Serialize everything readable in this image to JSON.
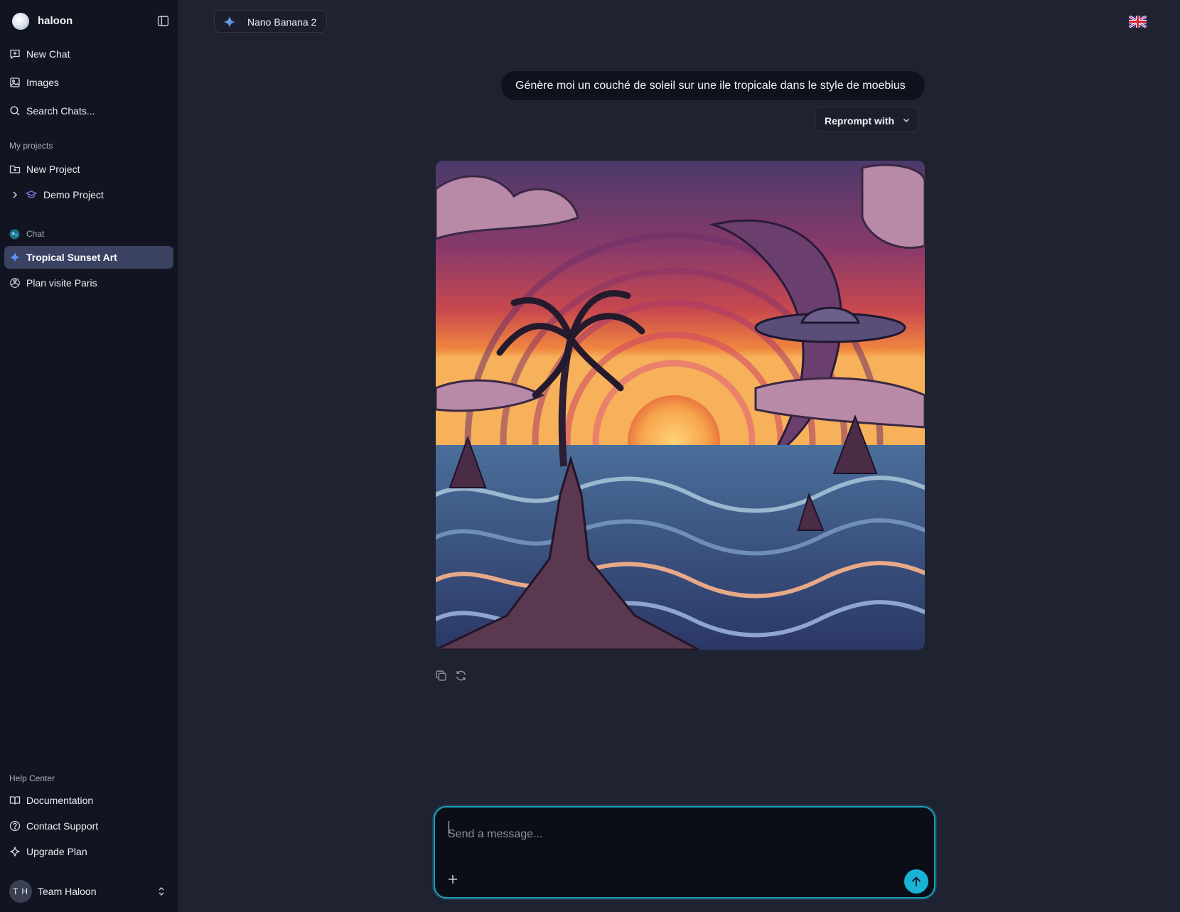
{
  "workspace": {
    "name": "haloon"
  },
  "nav": {
    "new_chat": "New Chat",
    "images": "Images",
    "search": "Search Chats..."
  },
  "projects": {
    "section_label": "My projects",
    "new_project": "New Project",
    "items": [
      {
        "label": "Demo Project"
      }
    ]
  },
  "chats": {
    "section_label": "Chat",
    "items": [
      {
        "label": "Tropical Sunset Art",
        "active": true
      },
      {
        "label": "Plan visite Paris",
        "active": false
      }
    ]
  },
  "help": {
    "section_label": "Help Center",
    "documentation": "Documentation",
    "contact_support": "Contact Support",
    "upgrade_plan": "Upgrade Plan"
  },
  "user": {
    "initials": "T H",
    "team_name": "Team Haloon"
  },
  "header": {
    "model_name": "Nano Banana 2",
    "language_flag": "uk-flag-icon"
  },
  "conversation": {
    "user_message": "Génère moi un couché de soleil sur une ile tropicale dans le style de moebius",
    "reprompt_label": "Reprompt with"
  },
  "composer": {
    "placeholder": "Send a message..."
  },
  "colors": {
    "sidebar_bg": "#121521",
    "main_bg": "#1f2230",
    "active_item": "#3a4161",
    "accent": "#19b3d6"
  }
}
